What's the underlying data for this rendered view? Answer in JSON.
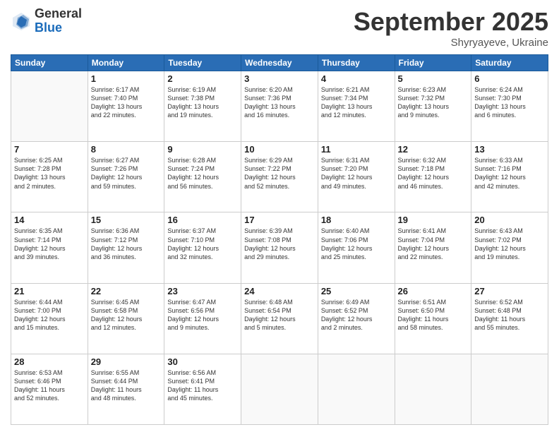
{
  "header": {
    "logo_general": "General",
    "logo_blue": "Blue",
    "month_title": "September 2025",
    "location": "Shyryayeve, Ukraine"
  },
  "days_of_week": [
    "Sunday",
    "Monday",
    "Tuesday",
    "Wednesday",
    "Thursday",
    "Friday",
    "Saturday"
  ],
  "weeks": [
    [
      {
        "day": "",
        "info": ""
      },
      {
        "day": "1",
        "info": "Sunrise: 6:17 AM\nSunset: 7:40 PM\nDaylight: 13 hours\nand 22 minutes."
      },
      {
        "day": "2",
        "info": "Sunrise: 6:19 AM\nSunset: 7:38 PM\nDaylight: 13 hours\nand 19 minutes."
      },
      {
        "day": "3",
        "info": "Sunrise: 6:20 AM\nSunset: 7:36 PM\nDaylight: 13 hours\nand 16 minutes."
      },
      {
        "day": "4",
        "info": "Sunrise: 6:21 AM\nSunset: 7:34 PM\nDaylight: 13 hours\nand 12 minutes."
      },
      {
        "day": "5",
        "info": "Sunrise: 6:23 AM\nSunset: 7:32 PM\nDaylight: 13 hours\nand 9 minutes."
      },
      {
        "day": "6",
        "info": "Sunrise: 6:24 AM\nSunset: 7:30 PM\nDaylight: 13 hours\nand 6 minutes."
      }
    ],
    [
      {
        "day": "7",
        "info": "Sunrise: 6:25 AM\nSunset: 7:28 PM\nDaylight: 13 hours\nand 2 minutes."
      },
      {
        "day": "8",
        "info": "Sunrise: 6:27 AM\nSunset: 7:26 PM\nDaylight: 12 hours\nand 59 minutes."
      },
      {
        "day": "9",
        "info": "Sunrise: 6:28 AM\nSunset: 7:24 PM\nDaylight: 12 hours\nand 56 minutes."
      },
      {
        "day": "10",
        "info": "Sunrise: 6:29 AM\nSunset: 7:22 PM\nDaylight: 12 hours\nand 52 minutes."
      },
      {
        "day": "11",
        "info": "Sunrise: 6:31 AM\nSunset: 7:20 PM\nDaylight: 12 hours\nand 49 minutes."
      },
      {
        "day": "12",
        "info": "Sunrise: 6:32 AM\nSunset: 7:18 PM\nDaylight: 12 hours\nand 46 minutes."
      },
      {
        "day": "13",
        "info": "Sunrise: 6:33 AM\nSunset: 7:16 PM\nDaylight: 12 hours\nand 42 minutes."
      }
    ],
    [
      {
        "day": "14",
        "info": "Sunrise: 6:35 AM\nSunset: 7:14 PM\nDaylight: 12 hours\nand 39 minutes."
      },
      {
        "day": "15",
        "info": "Sunrise: 6:36 AM\nSunset: 7:12 PM\nDaylight: 12 hours\nand 36 minutes."
      },
      {
        "day": "16",
        "info": "Sunrise: 6:37 AM\nSunset: 7:10 PM\nDaylight: 12 hours\nand 32 minutes."
      },
      {
        "day": "17",
        "info": "Sunrise: 6:39 AM\nSunset: 7:08 PM\nDaylight: 12 hours\nand 29 minutes."
      },
      {
        "day": "18",
        "info": "Sunrise: 6:40 AM\nSunset: 7:06 PM\nDaylight: 12 hours\nand 25 minutes."
      },
      {
        "day": "19",
        "info": "Sunrise: 6:41 AM\nSunset: 7:04 PM\nDaylight: 12 hours\nand 22 minutes."
      },
      {
        "day": "20",
        "info": "Sunrise: 6:43 AM\nSunset: 7:02 PM\nDaylight: 12 hours\nand 19 minutes."
      }
    ],
    [
      {
        "day": "21",
        "info": "Sunrise: 6:44 AM\nSunset: 7:00 PM\nDaylight: 12 hours\nand 15 minutes."
      },
      {
        "day": "22",
        "info": "Sunrise: 6:45 AM\nSunset: 6:58 PM\nDaylight: 12 hours\nand 12 minutes."
      },
      {
        "day": "23",
        "info": "Sunrise: 6:47 AM\nSunset: 6:56 PM\nDaylight: 12 hours\nand 9 minutes."
      },
      {
        "day": "24",
        "info": "Sunrise: 6:48 AM\nSunset: 6:54 PM\nDaylight: 12 hours\nand 5 minutes."
      },
      {
        "day": "25",
        "info": "Sunrise: 6:49 AM\nSunset: 6:52 PM\nDaylight: 12 hours\nand 2 minutes."
      },
      {
        "day": "26",
        "info": "Sunrise: 6:51 AM\nSunset: 6:50 PM\nDaylight: 11 hours\nand 58 minutes."
      },
      {
        "day": "27",
        "info": "Sunrise: 6:52 AM\nSunset: 6:48 PM\nDaylight: 11 hours\nand 55 minutes."
      }
    ],
    [
      {
        "day": "28",
        "info": "Sunrise: 6:53 AM\nSunset: 6:46 PM\nDaylight: 11 hours\nand 52 minutes."
      },
      {
        "day": "29",
        "info": "Sunrise: 6:55 AM\nSunset: 6:44 PM\nDaylight: 11 hours\nand 48 minutes."
      },
      {
        "day": "30",
        "info": "Sunrise: 6:56 AM\nSunset: 6:41 PM\nDaylight: 11 hours\nand 45 minutes."
      },
      {
        "day": "",
        "info": ""
      },
      {
        "day": "",
        "info": ""
      },
      {
        "day": "",
        "info": ""
      },
      {
        "day": "",
        "info": ""
      }
    ]
  ]
}
